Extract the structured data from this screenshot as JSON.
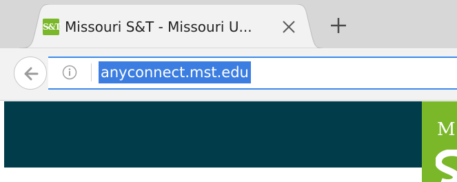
{
  "browser": {
    "tab": {
      "title": "Missouri S&T - Missouri U...",
      "favicon_text": "S&T",
      "favicon_icon": "mst-logo-icon",
      "close_icon": "close-icon"
    },
    "new_tab_icon": "plus-icon"
  },
  "toolbar": {
    "back_icon": "back-arrow-icon",
    "info_icon": "info-icon",
    "url": "anyconnect.mst.edu"
  },
  "page": {
    "logo_letter": "M",
    "colors": {
      "header": "#013c4a",
      "accent": "#7ab829",
      "selection": "#3b7de0"
    }
  }
}
